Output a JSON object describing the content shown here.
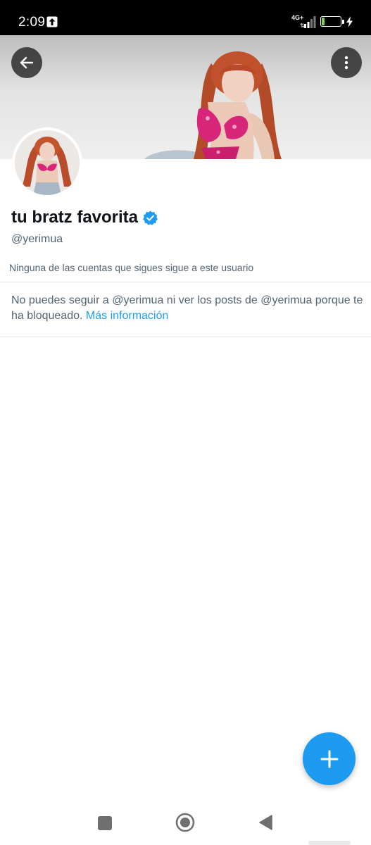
{
  "status_bar": {
    "time": "2:09",
    "network": "4G+",
    "battery_level": "22",
    "battery_fraction": 0.22,
    "battery_color": "#7fd14a",
    "icons": [
      "upload-icon",
      "signal-icon",
      "battery-icon",
      "charging-icon"
    ]
  },
  "header": {
    "back_icon": "arrow-left-icon",
    "more_icon": "more-vertical-icon"
  },
  "profile": {
    "display_name": "tu bratz favorita",
    "verified_icon": "verified-badge-icon",
    "verified_color": "#1d9bf0",
    "handle": "@yerimua",
    "followers_note": "Ninguna de las cuentas que sigues sigue a este usuario"
  },
  "blocked": {
    "message": "No puedes seguir a @yerimua ni ver los posts de @yerimua porque te ha bloqueado.",
    "link": "Más información"
  },
  "fab": {
    "icon": "plus-icon",
    "color": "#1d9bf0"
  },
  "nav_bar": {
    "icons": [
      "recents-square-icon",
      "home-circle-icon",
      "back-triangle-icon"
    ]
  },
  "colors": {
    "accent": "#1d9bf0",
    "primary_text": "#0f1419",
    "secondary_text": "#536471"
  }
}
